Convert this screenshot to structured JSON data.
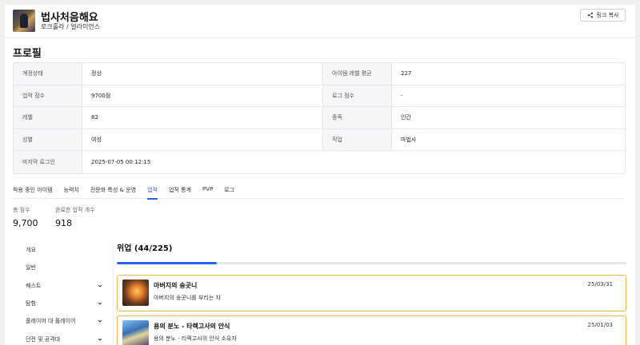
{
  "header": {
    "name": "법사처음해요",
    "server_guild": "로크홀라 / 얼라이언스",
    "copy_label": "링크 복사"
  },
  "profile": {
    "title": "프로필",
    "rows": [
      {
        "l1": "계정상태",
        "v1": "정상",
        "l2": "아이템 레벨 평균",
        "v2": "227"
      },
      {
        "l1": "업적 점수",
        "v1": "9700점",
        "l2": "로그 점수",
        "v2": "-"
      },
      {
        "l1": "레벨",
        "v1": "82",
        "l2": "종족",
        "v2": "인간"
      },
      {
        "l1": "성별",
        "v1": "여성",
        "l2": "직업",
        "v2": "마법사"
      }
    ],
    "last_login_label": "마지막 로그인",
    "last_login_value": "2025-07-05 00:12:15"
  },
  "tabs": [
    "착용 중인 아이템",
    "능력치",
    "전문화 특성 & 운영",
    "업적",
    "업적 통계",
    "PVP",
    "로그"
  ],
  "active_tab": "업적",
  "stats": {
    "total_label": "총 점수",
    "total_value": "9,700",
    "completed_label": "완료한 업적 개수",
    "completed_value": "918"
  },
  "sidebar": {
    "items": [
      "개요",
      "일반",
      "퀘스트",
      "탐험",
      "플레이어 대 플레이어",
      "던전 및 공격대"
    ]
  },
  "main": {
    "title": "위업 (44/225)",
    "progress_fraction": 0.196,
    "cards": [
      {
        "title": "아버지의 송곳니",
        "desc": "아버지의 송곳니를 부리는 자",
        "date": "25/03/31"
      },
      {
        "title": "용의 분노 - 타렉고사의 안식",
        "desc": "용의 분노 - 타렉고사의 안식 소유자",
        "date": "25/01/03"
      }
    ]
  },
  "colors": {
    "accent": "#2563eb",
    "card_border": "#f0b84a"
  }
}
